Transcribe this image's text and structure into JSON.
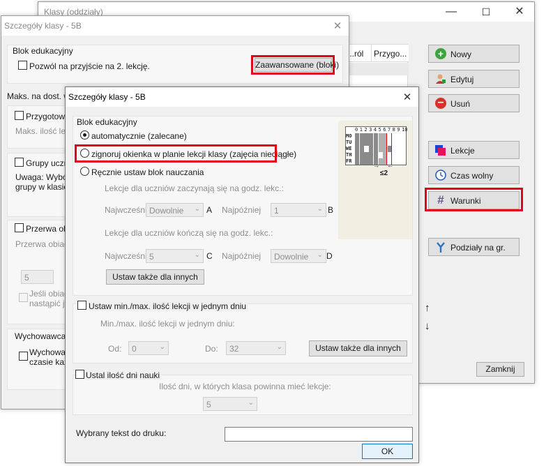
{
  "main_window": {
    "title": "Klasy (oddziały)",
    "table_headers": [
      "...ról",
      "Przygo..."
    ],
    "buttons": {
      "new": "Nowy",
      "edit": "Edytuj",
      "delete": "Usuń",
      "lessons": "Lekcje",
      "free_time": "Czas wolny",
      "conditions": "Warunki",
      "divisions": "Podziały na gr.",
      "close": "Zamknij"
    },
    "arrows": {
      "up": "↑",
      "down": "↓"
    }
  },
  "back_dialog": {
    "title": "Szczegóły klasy - 5B",
    "close_glyph": "✕",
    "group_block": "Blok edukacyjny",
    "allow_second": "Pozwól na przyjście na 2. lekcję.",
    "advanced_button": "Zaawansowane (bloki)",
    "max_label": "Maks. na dost. wa",
    "prep_label": "Przygotowa",
    "max_count": "Maks. ilość lekc",
    "groups_label": "Grupy uczni",
    "note_l1": "Uwaga: Wybór",
    "note_l2": "grupy w klasie",
    "lunch_label": "Przerwa obia",
    "lunch_dim": "Przerwa obiado",
    "lunch_value": "5",
    "lunch_note_l1": "Jeśli obiad",
    "lunch_note_l2": "nastąpić ju",
    "teacher_label": "Wychowawca:",
    "teacher_cb_l1": "Wychowaw",
    "teacher_cb_l2": "czasie każd"
  },
  "front_dialog": {
    "title": "Szczegóły klasy - 5B",
    "close_glyph": "✕",
    "group_title": "Blok edukacyjny",
    "radio_auto": "automatycznie (zalecane)",
    "radio_ignore": "zignoruj okienka w planie lekcji klasy (zajęcia nieciągłe)",
    "radio_manual": "Ręcznie ustaw blok nauczania",
    "start_caption": "Lekcje dla uczniów zaczynają się na godz. lekc.:",
    "earliest": "Najwcześnie",
    "latest": "Najpóźniej",
    "start_earliest_value": "Dowolnie",
    "start_latest_value": "1",
    "letter_a": "A",
    "letter_b": "B",
    "end_caption": "Lekcje dla uczniów kończą się na godz. lekc.:",
    "end_earliest_value": "5",
    "end_latest_value": "Dowolnie",
    "letter_c": "C",
    "letter_d": "D",
    "set_others": "Ustaw także dla innych",
    "minmax_label": "Ustaw min./max. ilość lekcji w jednym dniu",
    "minmax_caption": "Min./max. ilość lekcji w jednym dniu:",
    "from_label": "Od:",
    "from_value": "0",
    "to_label": "Do:",
    "to_value": "32",
    "set_others2": "Ustaw także dla innych",
    "days_label": "Ustal ilość dni nauki",
    "days_caption": "Ilość dni, w których klasa powinna mieć lekcje:",
    "days_value": "5",
    "print_label": "Wybrany tekst do druku:",
    "print_value": "",
    "ok": "OK",
    "diagram": {
      "days": [
        "MO",
        "TU",
        "WE",
        "TH",
        "FR"
      ],
      "periods": [
        "0",
        "1",
        "2",
        "3",
        "4",
        "5",
        "6",
        "7",
        "8",
        "9",
        "10"
      ],
      "note": "≤2"
    }
  },
  "colors": {
    "highlight": "#e2061b",
    "lesson_cell": "#8a8a8a",
    "panel": "#f0f0f0"
  }
}
